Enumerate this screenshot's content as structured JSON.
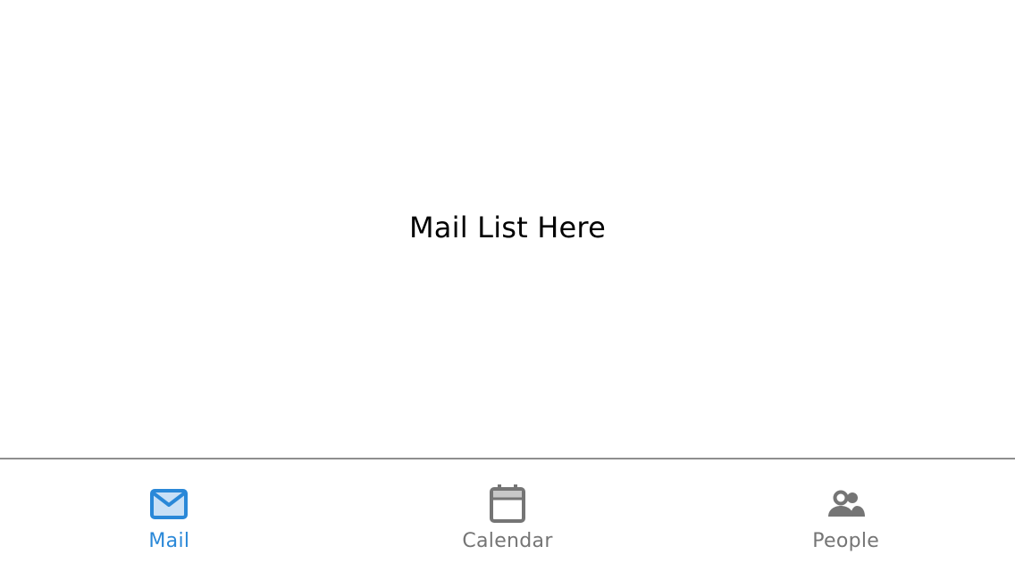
{
  "main": {
    "placeholder_text": "Mail List Here"
  },
  "tabbar": {
    "active_color": "#2a88d8",
    "inactive_color": "#757575",
    "tabs": [
      {
        "label": "Mail",
        "icon": "mail-icon",
        "active": true
      },
      {
        "label": "Calendar",
        "icon": "calendar-icon",
        "active": false
      },
      {
        "label": "People",
        "icon": "people-icon",
        "active": false
      }
    ]
  }
}
